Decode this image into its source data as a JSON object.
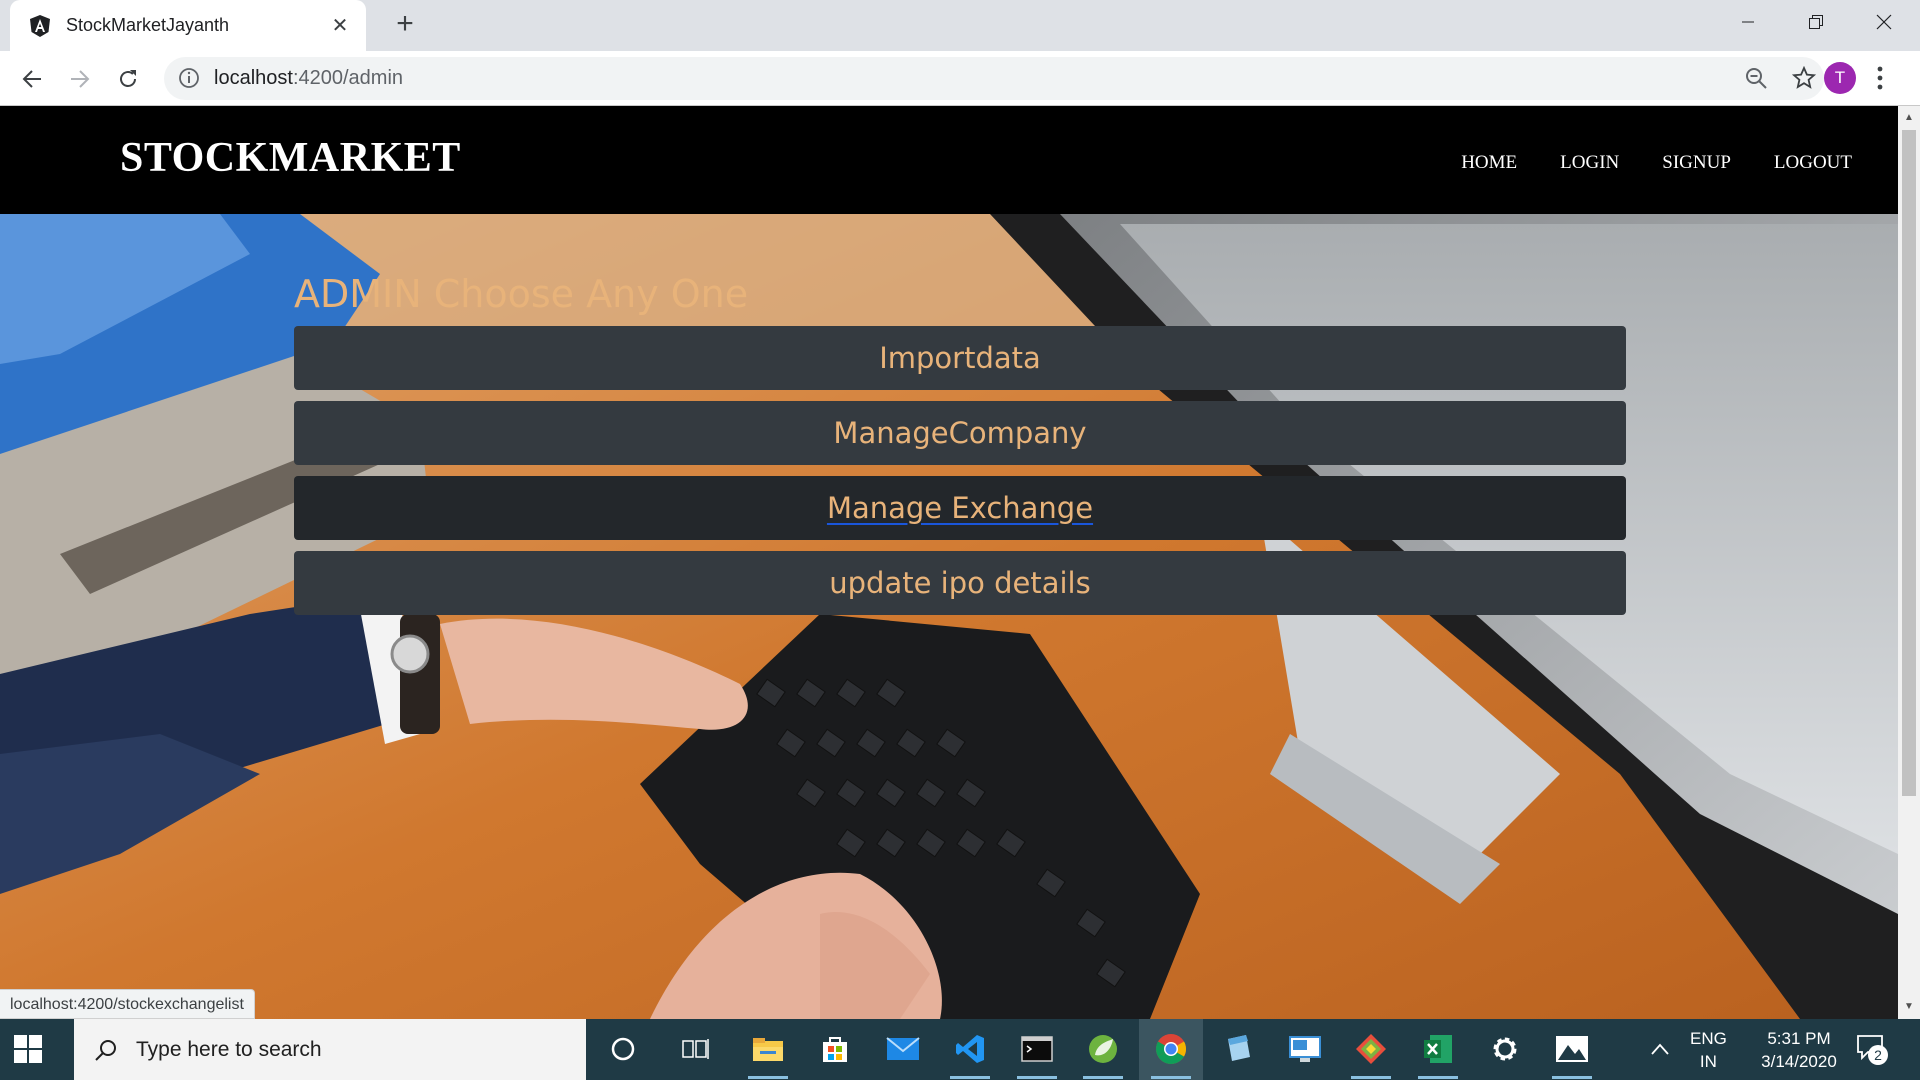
{
  "browser": {
    "tab_title": "StockMarketJayanth",
    "url_host": "localhost",
    "url_path": ":4200/admin",
    "profile_initial": "T"
  },
  "navbar": {
    "brand": "STOCKMARKET",
    "links": [
      "HOME",
      "LOGIN",
      "SIGNUP",
      "LOGOUT"
    ]
  },
  "admin": {
    "heading": "ADMIN Choose Any One",
    "buttons": [
      "Importdata",
      "ManageCompany",
      "Manage Exchange",
      "update ipo details"
    ],
    "hovered_button": "Manage Exchange"
  },
  "status_bar": {
    "link_preview": "localhost:4200/stockexchangelist"
  },
  "taskbar": {
    "search_placeholder": "Type here to search",
    "language_line1": "ENG",
    "language_line2": "IN",
    "time": "5:31 PM",
    "date": "3/14/2020",
    "notification_count": "2"
  },
  "colors": {
    "navbar_bg": "#000000",
    "button_bg": "#343a40",
    "button_text": "#e8b37a",
    "taskbar_bg": "#1f3a45"
  }
}
